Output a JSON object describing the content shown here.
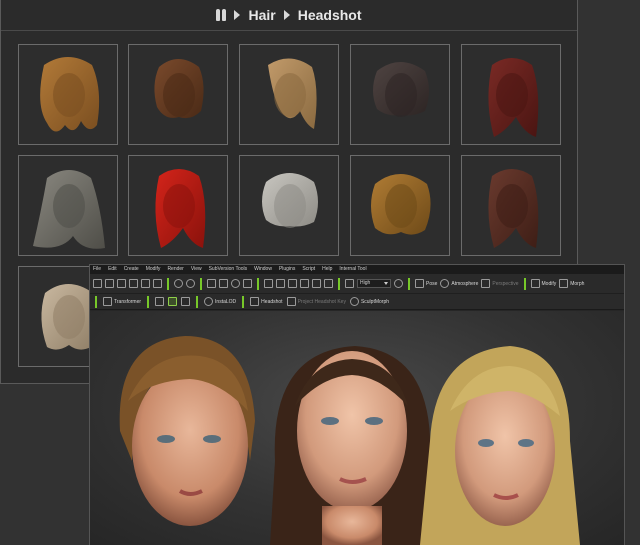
{
  "breadcrumb": {
    "root": "Hair",
    "current": "Headshot"
  },
  "hair_tiles": [
    {
      "color": "#b27a38",
      "shade": "#7a4e20",
      "style": "wavy-long"
    },
    {
      "color": "#7a4a2c",
      "shade": "#4a2a16",
      "style": "short-curly"
    },
    {
      "color": "#c19a6a",
      "shade": "#8a6a40",
      "style": "medium-side"
    },
    {
      "color": "#4f4442",
      "shade": "#2d2524",
      "style": "short-bob"
    },
    {
      "color": "#7a2a25",
      "shade": "#4a1512",
      "style": "long-straight"
    },
    {
      "color": "#8a8880",
      "shade": "#4f4e48",
      "style": "long-layered"
    },
    {
      "color": "#d4241a",
      "shade": "#8a120c",
      "style": "long-straight"
    },
    {
      "color": "#c8c6c0",
      "shade": "#8e8c86",
      "style": "short-bob"
    },
    {
      "color": "#b07c34",
      "shade": "#6e4a18",
      "style": "curly-bob"
    },
    {
      "color": "#6a3a2e",
      "shade": "#3e1e16",
      "style": "long-straight"
    },
    {
      "color": "#c9b8a0",
      "shade": "#8f7e66",
      "style": "medium-bob"
    }
  ],
  "app": {
    "menu": [
      "File",
      "Edit",
      "Create",
      "Modify",
      "Render",
      "View",
      "SubVersion Tools",
      "Window",
      "Plugins",
      "Script",
      "Help",
      "Internal Tool"
    ],
    "render_quality": "High",
    "toolbar1_labels": {
      "pose": "Pose",
      "atmosphere": "Atmosphere",
      "disabled1": "Perspective",
      "modify": "Modify",
      "morph": "Morph"
    },
    "toolbar2_labels": {
      "transformer": "Transformer",
      "instaLOD": "InstaLOD",
      "headshot": "Headshot",
      "disabled2": "Project Headshot Key",
      "sculptmorph": "SculptMorph"
    }
  },
  "colors": {
    "accent_green": "#77c829",
    "panel_bg": "#2b2b2b",
    "tile_border": "#6b6b6b"
  }
}
